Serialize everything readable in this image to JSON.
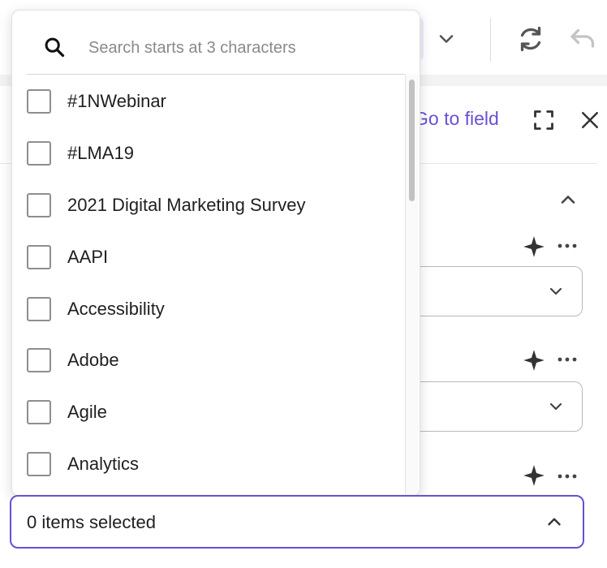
{
  "search": {
    "placeholder": "Search starts at 3 characters",
    "value": ""
  },
  "header": {
    "go_to_field_label": "Go to field"
  },
  "options": [
    {
      "label": "#1NWebinar",
      "checked": false
    },
    {
      "label": "#LMA19",
      "checked": false
    },
    {
      "label": "2021 Digital Marketing Survey",
      "checked": false
    },
    {
      "label": "AAPI",
      "checked": false
    },
    {
      "label": "Accessibility",
      "checked": false
    },
    {
      "label": "Adobe",
      "checked": false
    },
    {
      "label": "Agile",
      "checked": false
    },
    {
      "label": "Analytics",
      "checked": false
    }
  ],
  "selection": {
    "summary": "0 items selected"
  },
  "colors": {
    "accent": "#6a4fd8",
    "border": "#b9b9b9",
    "checkbox_border": "#8e8e8e"
  },
  "icons": [
    "search-icon",
    "chevron-down-icon",
    "refresh-icon",
    "undo-icon",
    "expand-icon",
    "close-icon",
    "chevron-up-icon",
    "sparkle-icon",
    "more-icon"
  ]
}
